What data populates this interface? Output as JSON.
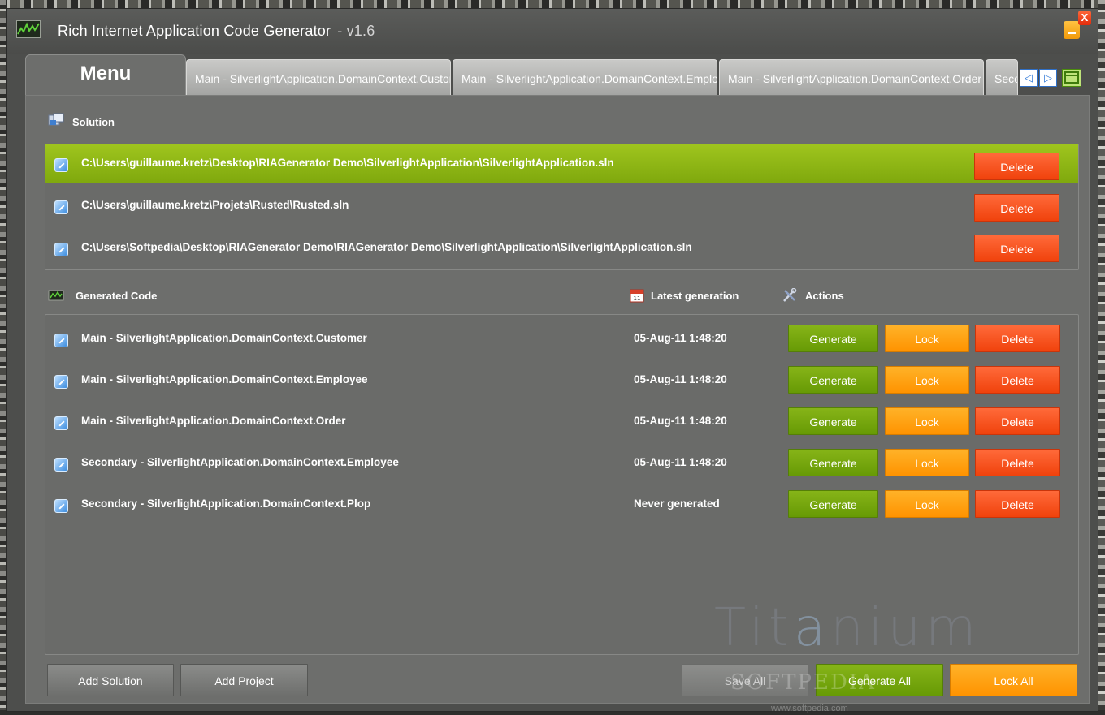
{
  "window": {
    "title": "Rich Internet Application Code Generator",
    "version": "-  v1.6",
    "close_glyph": "X"
  },
  "tabs": {
    "menu": "Menu",
    "items": [
      "Main - SilverlightApplication.DomainContext.Customer",
      "Main - SilverlightApplication.DomainContext.Employee",
      "Main - SilverlightApplication.DomainContext.Order",
      "Secondary - SilverlightApplication.DomainContext.Employee"
    ],
    "nav_prev": "◁",
    "nav_next": "▷"
  },
  "solution": {
    "label": "Solution",
    "rows": [
      {
        "path": "C:\\Users\\guillaume.kretz\\Desktop\\RIAGenerator Demo\\SilverlightApplication\\SilverlightApplication.sln",
        "delete": "Delete",
        "selected": true
      },
      {
        "path": "C:\\Users\\guillaume.kretz\\Projets\\Rusted\\Rusted.sln",
        "delete": "Delete",
        "selected": false
      },
      {
        "path": "C:\\Users\\Softpedia\\Desktop\\RIAGenerator Demo\\RIAGenerator Demo\\SilverlightApplication\\SilverlightApplication.sln",
        "delete": "Delete",
        "selected": false
      }
    ]
  },
  "generated": {
    "label": "Generated Code",
    "latest_label": "Latest generation",
    "actions_label": "Actions",
    "rows": [
      {
        "name": "Main - SilverlightApplication.DomainContext.Customer",
        "date": "05-Aug-11 1:48:20",
        "generate": "Generate",
        "lock": "Lock",
        "delete": "Delete"
      },
      {
        "name": "Main - SilverlightApplication.DomainContext.Employee",
        "date": "05-Aug-11 1:48:20",
        "generate": "Generate",
        "lock": "Lock",
        "delete": "Delete"
      },
      {
        "name": "Main - SilverlightApplication.DomainContext.Order",
        "date": "05-Aug-11 1:48:20",
        "generate": "Generate",
        "lock": "Lock",
        "delete": "Delete"
      },
      {
        "name": "Secondary - SilverlightApplication.DomainContext.Employee",
        "date": "05-Aug-11 1:48:20",
        "generate": "Generate",
        "lock": "Lock",
        "delete": "Delete"
      },
      {
        "name": "Secondary - SilverlightApplication.DomainContext.Plop",
        "date": "Never generated",
        "generate": "Generate",
        "lock": "Lock",
        "delete": "Delete"
      }
    ]
  },
  "footer": {
    "add_solution": "Add Solution",
    "add_project": "Add Project",
    "save_all": "Save All",
    "generate_all": "Generate All",
    "lock_all": "Lock All"
  },
  "branding": {
    "watermark_pre": "Tit",
    "watermark_a": "a",
    "watermark_post": "nium",
    "softpedia": "SOFTPEDIA",
    "softpedia_url": "www.softpedia.com"
  },
  "colors": {
    "selected_row": "#8cb814",
    "delete": "#f24a10",
    "generate": "#75a60c",
    "lock": "#ff9a0a"
  }
}
